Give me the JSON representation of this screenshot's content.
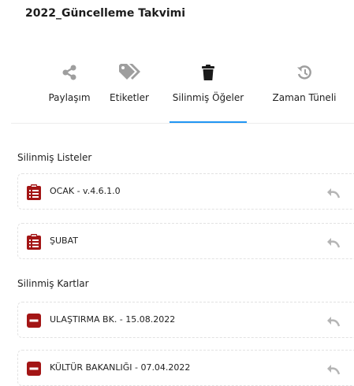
{
  "page": {
    "title": "2022_Güncelleme Takvimi"
  },
  "tabs": [
    {
      "label": "Paylaşım",
      "icon": "share-icon",
      "active": false
    },
    {
      "label": "Etiketler",
      "icon": "tags-icon",
      "active": false
    },
    {
      "label": "Silinmiş Öğeler",
      "icon": "trash-icon",
      "active": true
    },
    {
      "label": "Zaman Tüneli",
      "icon": "history-icon",
      "active": false
    }
  ],
  "deleted_lists": {
    "title": "Silinmiş Listeler",
    "items": [
      {
        "label": "OCAK - v.4.6.1.0",
        "icon": "clipboard-list-icon"
      },
      {
        "label": "ŞUBAT",
        "icon": "clipboard-list-icon"
      }
    ]
  },
  "deleted_cards": {
    "title": "Silinmiş Kartlar",
    "items": [
      {
        "label": "ULAŞTIRMA BK. - 15.08.2022",
        "icon": "minus-square-icon"
      },
      {
        "label": "KÜLTÜR BAKANLIĞI - 07.04.2022",
        "icon": "minus-square-icon"
      }
    ]
  },
  "colors": {
    "accent": "#2196f3",
    "icon_gray": "#9e9e9e",
    "deleted_red": "#a31515",
    "restore_gray": "#b5b5b5"
  }
}
